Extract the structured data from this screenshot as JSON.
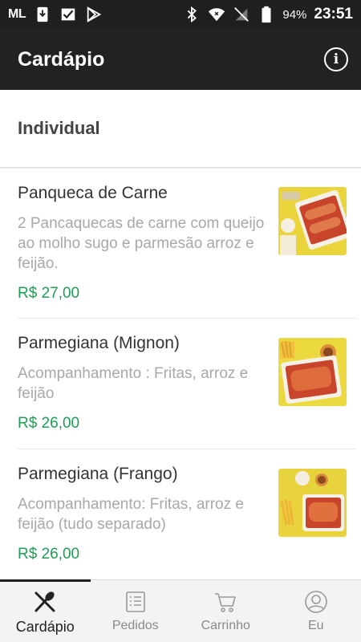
{
  "status_bar": {
    "left_text": "ML",
    "battery": "94%",
    "time": "23:51"
  },
  "app_bar": {
    "title": "Cardápio",
    "info_label": "i"
  },
  "section": {
    "title": "Individual"
  },
  "items": [
    {
      "name": "Panqueca de Carne",
      "description": "2 Pancaquecas de carne com queijo ao molho sugo e parmesão arroz e feijão.",
      "price": "R$ 27,00"
    },
    {
      "name": "Parmegiana (Mignon)",
      "description": "Acompanhamento : Fritas, arroz e feijão",
      "price": "R$ 26,00"
    },
    {
      "name": "Parmegiana (Frango)",
      "description": "Acompanhamento: Fritas, arroz e feijão (tudo separado)",
      "price": "R$ 26,00"
    }
  ],
  "bottom_nav": [
    {
      "label": "Cardápio",
      "icon": "utensils-icon",
      "active": true
    },
    {
      "label": "Pedidos",
      "icon": "list-icon",
      "active": false
    },
    {
      "label": "Carrinho",
      "icon": "cart-icon",
      "active": false
    },
    {
      "label": "Eu",
      "icon": "user-icon",
      "active": false
    }
  ],
  "colors": {
    "app_bar": "#222222",
    "price": "#1f9d55",
    "description": "#a8a8a8"
  }
}
